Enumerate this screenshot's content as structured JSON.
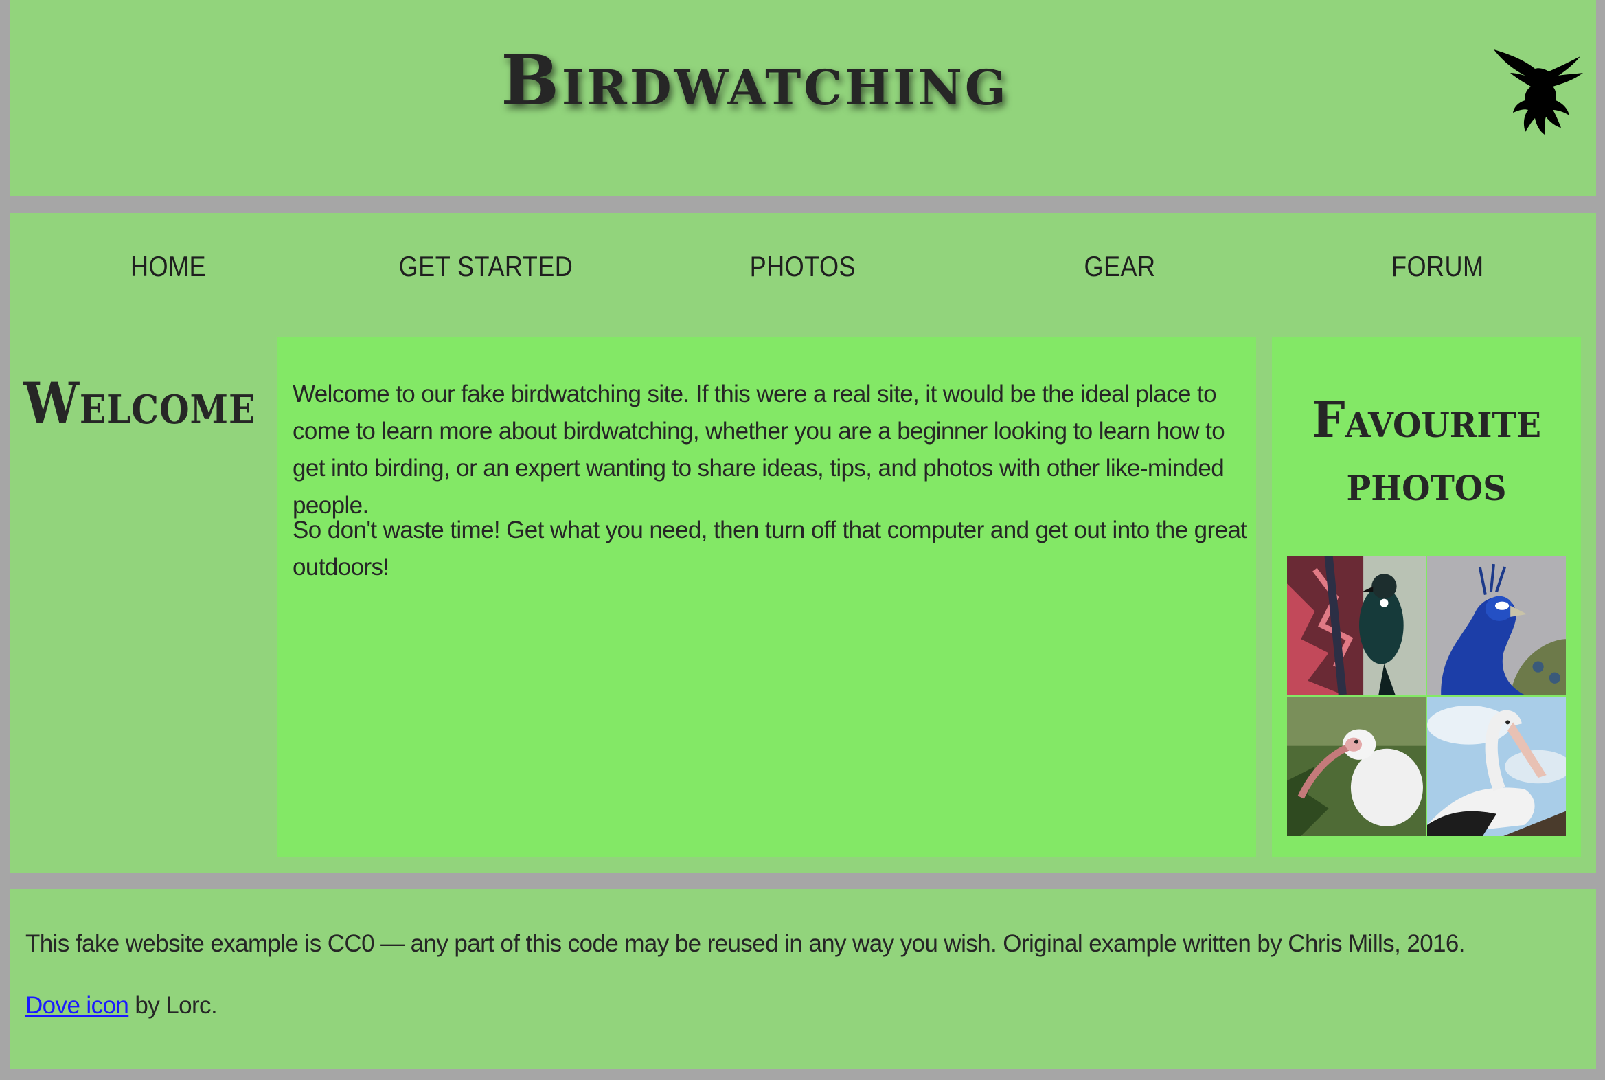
{
  "header": {
    "title": "Birdwatching",
    "logo_icon": "dove-icon"
  },
  "nav": {
    "items": [
      {
        "label": "HOME"
      },
      {
        "label": "GET STARTED"
      },
      {
        "label": "PHOTOS"
      },
      {
        "label": "GEAR"
      },
      {
        "label": "FORUM"
      }
    ]
  },
  "main": {
    "heading": "Welcome",
    "paragraphs": [
      "Welcome to our fake birdwatching site. If this were a real site, it would be the ideal place to come to learn more about birdwatching, whether you are a beginner looking to learn how to get into birding, or an expert wanting to share ideas, tips, and photos with other like-minded people.",
      "So don't waste time! Get what you need, then turn off that computer and get out into the great outdoors!"
    ]
  },
  "aside": {
    "heading": "Favourite photos",
    "photos": [
      "tui-photo",
      "peacock-photo",
      "ibis-photo",
      "pelican-photo"
    ]
  },
  "footer": {
    "license_text": "This fake website example is CC0 — any part of this code may be reused in any way you wish. Original example written by Chris Mills, 2016.",
    "credit_link": "Dove icon",
    "credit_suffix": " by Lorc."
  },
  "colors": {
    "page_background": "#a6a6a6",
    "panel_background": "#92d47c",
    "content_background": "#83e866",
    "link": "#1a1aff"
  }
}
